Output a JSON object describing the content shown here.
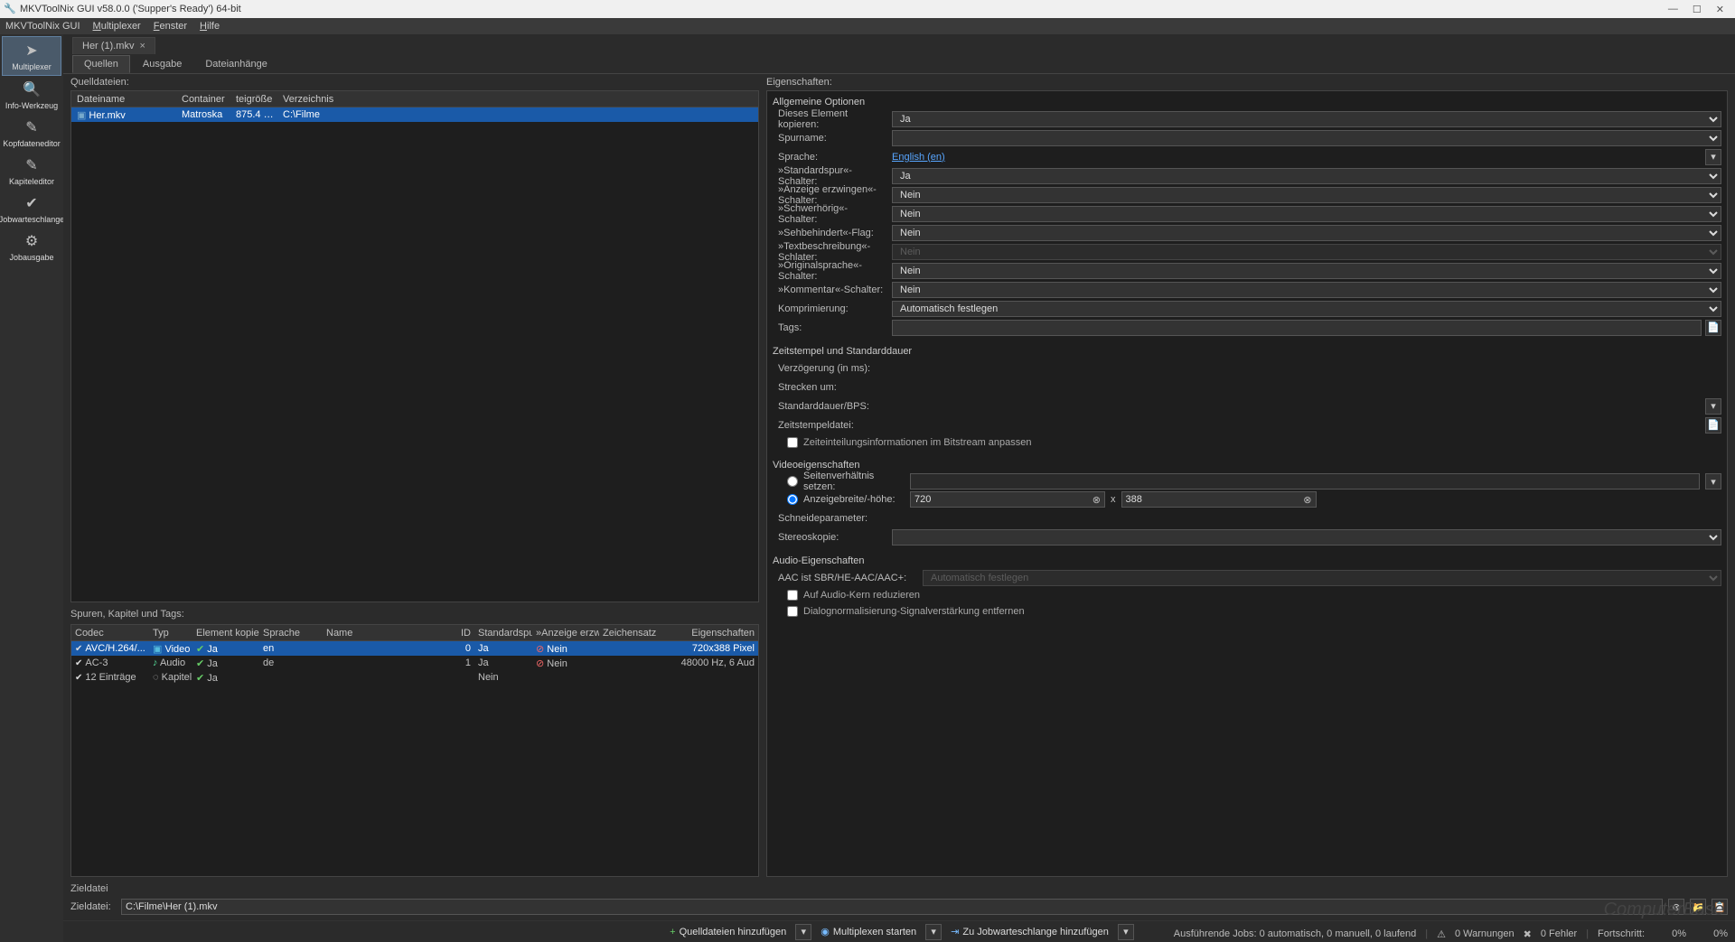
{
  "title": "MKVToolNix GUI v58.0.0 ('Supper's Ready') 64-bit",
  "menubar": [
    "MKVToolNix GUI",
    "Multiplexer",
    "Fenster",
    "Hilfe"
  ],
  "sidebar": [
    {
      "label": "Multiplexer"
    },
    {
      "label": "Info-Werkzeug"
    },
    {
      "label": "Kopfdateneditor"
    },
    {
      "label": "Kapiteleditor"
    },
    {
      "label": "Jobwarteschlange"
    },
    {
      "label": "Jobausgabe"
    }
  ],
  "file_tab": "Her (1).mkv",
  "subtabs": [
    "Quellen",
    "Ausgabe",
    "Dateianhänge"
  ],
  "sources": {
    "label": "Quelldateien:",
    "headers": {
      "file": "Dateiname",
      "container": "Container",
      "size": "teigröße",
      "dir": "Verzeichnis"
    },
    "rows": [
      {
        "file": "Her.mkv",
        "container": "Matroska",
        "size": "875.4 …",
        "dir": "C:\\Filme"
      }
    ]
  },
  "tracks": {
    "label": "Spuren, Kapitel und Tags:",
    "headers": {
      "codec": "Codec",
      "typ": "Typ",
      "copy": "Element kopieren",
      "lang": "Sprache",
      "name": "Name",
      "id": "ID",
      "default": "Standardspur",
      "force": "»Anzeige erzwinge",
      "charset": "Zeichensatz",
      "props": "Eigenschaften"
    },
    "rows": [
      {
        "codec": "AVC/H.264/...",
        "typ": "Video",
        "copy": "Ja",
        "lang": "en",
        "id": "0",
        "default": "Ja",
        "force": "Nein",
        "props": "720x388 Pixel",
        "sel": true
      },
      {
        "codec": "AC-3",
        "typ": "Audio",
        "copy": "Ja",
        "lang": "de",
        "id": "1",
        "default": "Ja",
        "force": "Nein",
        "props": "48000 Hz, 6 Aud"
      },
      {
        "codec": "12 Einträge",
        "typ": "Kapitel",
        "copy": "Ja",
        "lang": "",
        "id": "",
        "default": "Nein",
        "force": "",
        "props": ""
      }
    ]
  },
  "props": {
    "header": "Eigenschaften:",
    "group_general": "Allgemeine Optionen",
    "copy_elem": {
      "label": "Dieses Element kopieren:",
      "value": "Ja"
    },
    "trackname": {
      "label": "Spurname:"
    },
    "language": {
      "label": "Sprache:",
      "value": "English (en)"
    },
    "default_switch": {
      "label": "»Standardspur«-Schalter:",
      "value": "Ja"
    },
    "force_switch": {
      "label": "»Anzeige erzwingen«-Schalter:",
      "value": "Nein"
    },
    "deaf_switch": {
      "label": "»Schwerhörig«-Schalter:",
      "value": "Nein"
    },
    "blind_flag": {
      "label": "»Sehbehindert«-Flag:",
      "value": "Nein"
    },
    "textdesc_switch": {
      "label": "»Textbeschreibung«-Schlater:",
      "value": "Nein"
    },
    "origlang_switch": {
      "label": "»Originalsprache«-Schalter:",
      "value": "Nein"
    },
    "comment_switch": {
      "label": "»Kommentar«-Schalter:",
      "value": "Nein"
    },
    "compression": {
      "label": "Komprimierung:",
      "value": "Automatisch festlegen"
    },
    "tags_label": "Tags:",
    "group_timestamps": "Zeitstempel und Standarddauer",
    "delay_label": "Verzögerung (in ms):",
    "stretch_label": "Strecken um:",
    "duration_label": "Standarddauer/BPS:",
    "tsfile_label": "Zeitstempeldatei:",
    "bitstream_check": "Zeiteinteilungsinformationen im Bitstream anpassen",
    "group_video": "Videoeigenschaften",
    "aspect_label": "Seitenverhältnis setzen:",
    "dims_label": "Anzeigebreite/-höhe:",
    "dim_w": "720",
    "dim_x": "x",
    "dim_h": "388",
    "crop_label": "Schneideparameter:",
    "stereo_label": "Stereoskopie:",
    "group_audio": "Audio-Eigenschaften",
    "aac_label": "AAC ist SBR/HE-AAC/AAC+:",
    "aac_value": "Automatisch festlegen",
    "reduce_core": "Auf Audio-Kern reduzieren",
    "dialnorm": "Dialognormalisierung-Signalverstärkung entfernen"
  },
  "dest": {
    "section": "Zieldatei",
    "label": "Zieldatei:",
    "value": "C:\\Filme\\Her (1).mkv"
  },
  "actions": {
    "add_sources": "Quelldateien hinzufügen",
    "mux_start": "Multiplexen starten",
    "to_queue": "Zu Jobwarteschlange hinzufügen"
  },
  "status": {
    "jobs": "Ausführende Jobs: 0 automatisch, 0 manuell, 0 laufend",
    "warnings": "0 Warnungen",
    "errors": "0 Fehler",
    "progress_label": "Fortschritt:",
    "progress1": "0%",
    "progress2": "0%"
  },
  "watermark": "ComputerBase"
}
